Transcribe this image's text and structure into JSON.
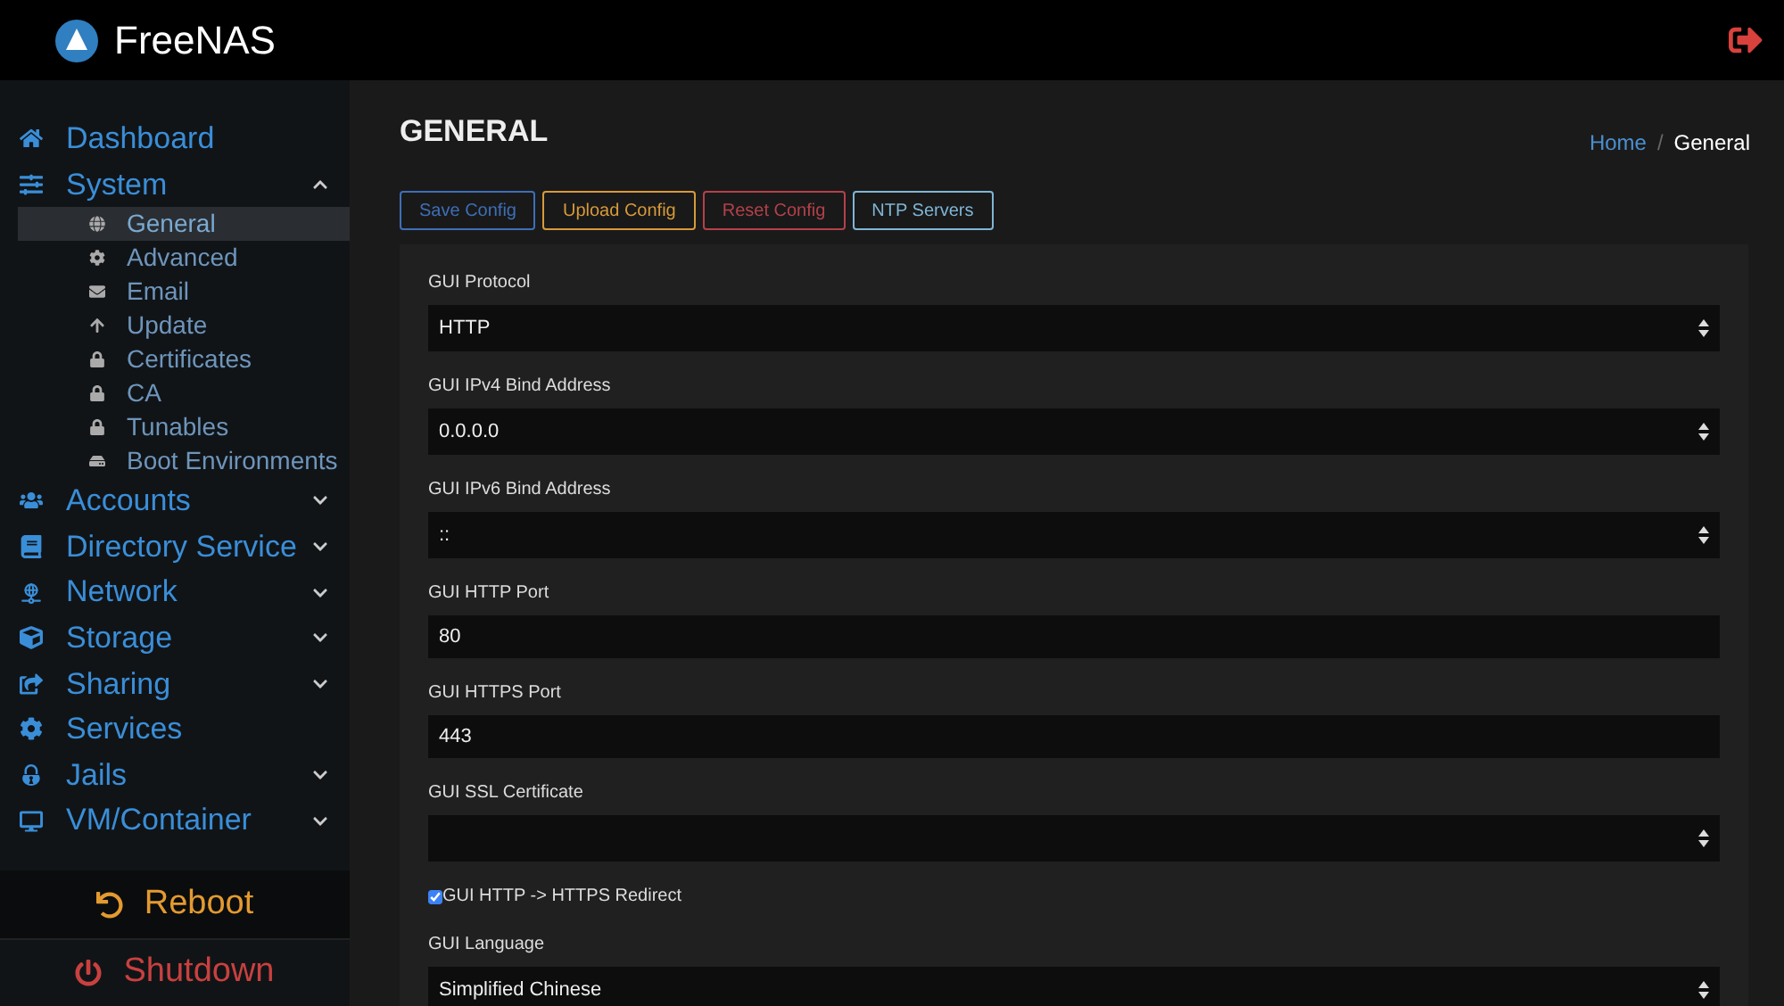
{
  "topbar": {
    "logo": "FreeNAS"
  },
  "sidebar": {
    "items": [
      {
        "label": "Dashboard"
      },
      {
        "label": "System",
        "expanded": true,
        "children": [
          {
            "label": "General",
            "selected": true
          },
          {
            "label": "Advanced",
            "selected": false
          },
          {
            "label": "Email",
            "selected": false
          },
          {
            "label": "Update",
            "selected": false
          },
          {
            "label": "Certificates",
            "selected": false
          },
          {
            "label": "CA",
            "selected": false
          },
          {
            "label": "Tunables",
            "selected": false
          },
          {
            "label": "Boot Environments",
            "selected": false
          }
        ]
      },
      {
        "label": "Accounts",
        "expanded": false
      },
      {
        "label": "Directory Service",
        "expanded": false
      },
      {
        "label": "Network",
        "expanded": false
      },
      {
        "label": "Storage",
        "expanded": false
      },
      {
        "label": "Sharing",
        "expanded": false
      },
      {
        "label": "Services"
      },
      {
        "label": "Jails",
        "expanded": false
      },
      {
        "label": "VM/Container",
        "expanded": false
      }
    ],
    "reboot": "Reboot",
    "shutdown": "Shutdown"
  },
  "page": {
    "title": "GENERAL",
    "breadcrumb": [
      "Home",
      "General"
    ],
    "breadcrumb_separator": "/",
    "buttons": [
      {
        "label": "Save Config",
        "color": "#3d6fb8"
      },
      {
        "label": "Upload Config",
        "color": "#d79a3a"
      },
      {
        "label": "Reset Config",
        "color": "#b4414a"
      },
      {
        "label": "NTP Servers",
        "color": "#7fb5d6"
      }
    ],
    "fields": [
      {
        "kind": "select",
        "label": "GUI Protocol",
        "value": "HTTP"
      },
      {
        "kind": "select",
        "label": "GUI IPv4 Bind Address",
        "value": "0.0.0.0"
      },
      {
        "kind": "select",
        "label": "GUI IPv6 Bind Address",
        "value": "::"
      },
      {
        "kind": "text",
        "label": "GUI HTTP Port",
        "value": "80"
      },
      {
        "kind": "text",
        "label": "GUI HTTPS Port",
        "value": "443"
      },
      {
        "kind": "select",
        "label": "GUI SSL Certificate"
      },
      {
        "kind": "checkbox",
        "label": "GUI HTTP -> HTTPS Redirect",
        "checked": true
      },
      {
        "kind": "select",
        "label": "GUI Language",
        "value": "Simplified Chinese"
      }
    ]
  }
}
